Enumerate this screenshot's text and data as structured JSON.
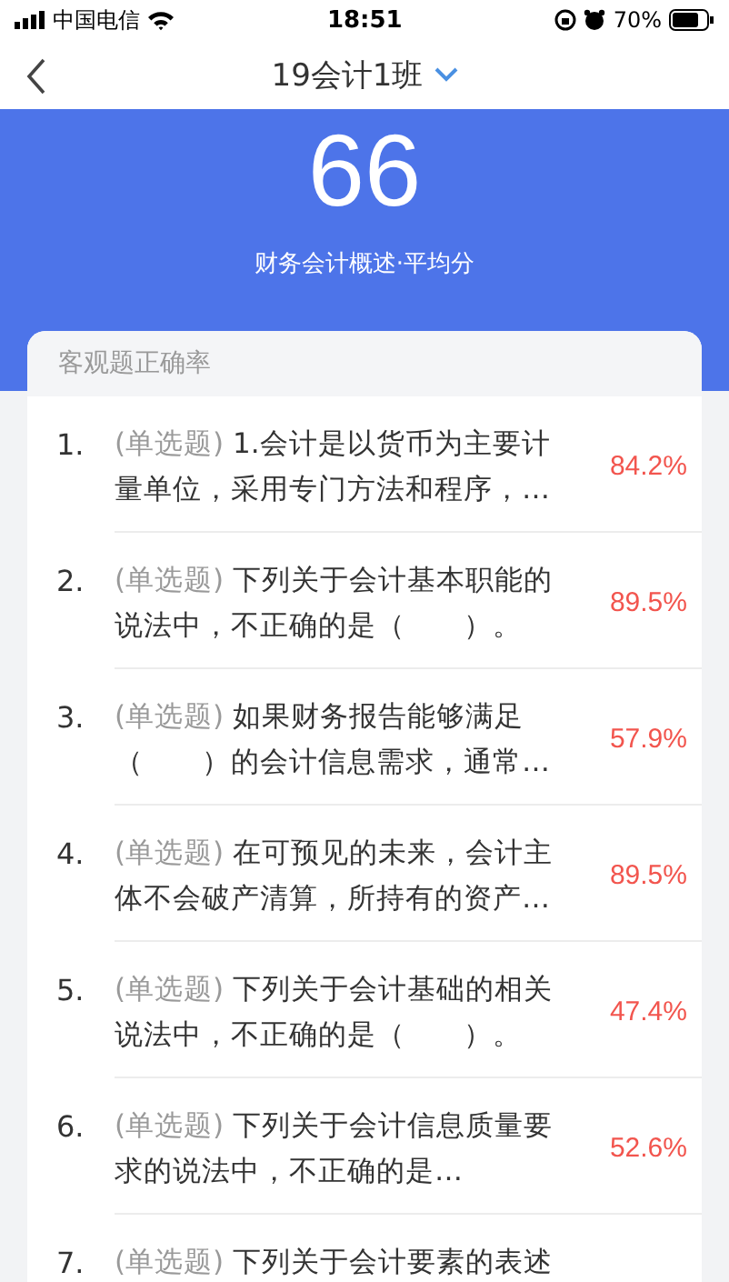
{
  "status_bar": {
    "carrier": "中国电信",
    "time": "18:51",
    "battery": "70%"
  },
  "nav": {
    "title": "19会计1班"
  },
  "header": {
    "score": "66",
    "caption": "财务会计概述·平均分"
  },
  "card": {
    "title": "客观题正确率",
    "questions": [
      {
        "number": "1.",
        "tag": "(单选题)",
        "text": "1.会计是以货币为主要计量单位，采用专门方法和程序，…",
        "rate": "84.2%"
      },
      {
        "number": "2.",
        "tag": "(单选题)",
        "text": "下列关于会计基本职能的说法中，不正确的是（　　）。",
        "rate": "89.5%"
      },
      {
        "number": "3.",
        "tag": "(单选题)",
        "text": "如果财务报告能够满足（　　）的会计信息需求，通常…",
        "rate": "57.9%"
      },
      {
        "number": "4.",
        "tag": "(单选题)",
        "text": "在可预见的未来，会计主体不会破产清算，所持有的资产…",
        "rate": "89.5%"
      },
      {
        "number": "5.",
        "tag": "(单选题)",
        "text": "下列关于会计基础的相关说法中，不正确的是（　　）。",
        "rate": "47.4%"
      },
      {
        "number": "6.",
        "tag": "(单选题)",
        "text": "下列关于会计信息质量要求的说法中，不正确的是…",
        "rate": "52.6%"
      },
      {
        "number": "7.",
        "tag": "(单选题)",
        "text": "下列关于会计要素的表述"
      }
    ]
  }
}
